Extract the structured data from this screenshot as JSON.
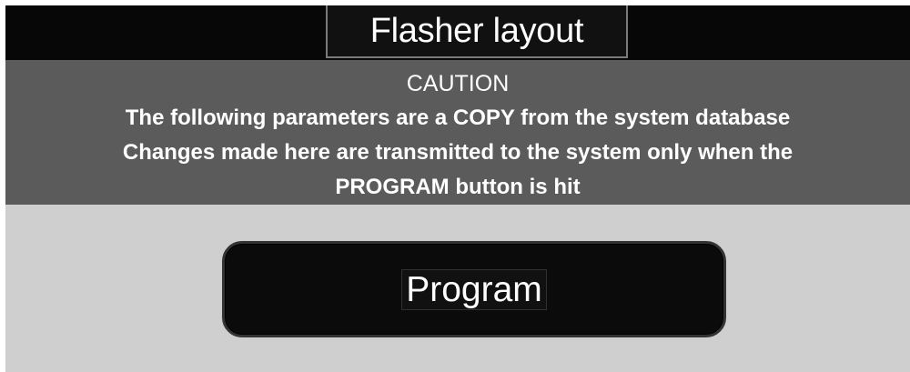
{
  "window": {
    "title": "Flasher layout"
  },
  "caution": {
    "title": "CAUTION",
    "lines": [
      "The following parameters are a COPY from the system database",
      "Changes made here are transmitted to the system only when the",
      "PROGRAM button is hit"
    ]
  },
  "actions": {
    "program_label": "Program"
  },
  "colors": {
    "title_bar": "#070707",
    "caution_panel": "#5b5b5b",
    "lower_panel": "#cfcfcf",
    "button": "#0b0b0b",
    "text": "#ffffff"
  }
}
